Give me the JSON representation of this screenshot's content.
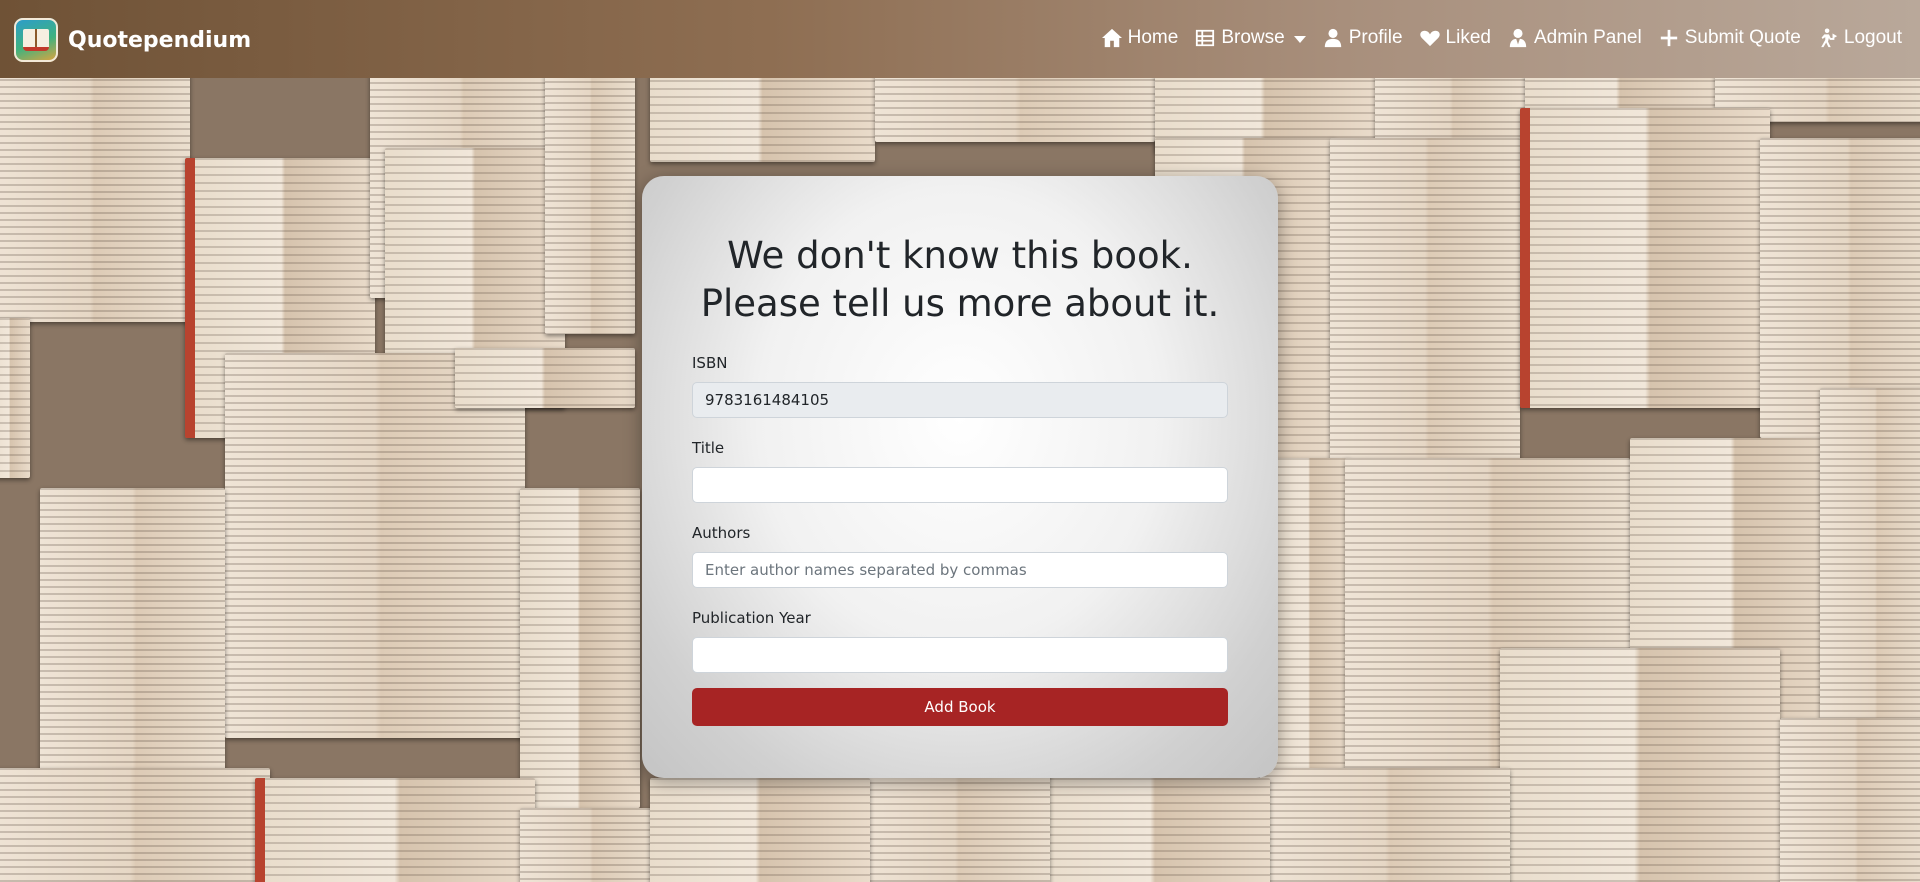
{
  "brand": {
    "name": "Quotependium",
    "logo_icon": "book-logo-icon"
  },
  "nav": {
    "home": {
      "label": "Home",
      "icon": "home-icon"
    },
    "browse": {
      "label": "Browse",
      "icon": "table-icon"
    },
    "profile": {
      "label": "Profile",
      "icon": "user-icon"
    },
    "liked": {
      "label": "Liked",
      "icon": "heart-icon"
    },
    "admin": {
      "label": "Admin Panel",
      "icon": "user-tie-icon"
    },
    "submit": {
      "label": "Submit Quote",
      "icon": "plus-icon"
    },
    "logout": {
      "label": "Logout",
      "icon": "logout-icon"
    }
  },
  "form": {
    "heading_line1": "We don't know this book.",
    "heading_line2": "Please tell us more about it.",
    "isbn": {
      "label": "ISBN",
      "value": "9783161484105"
    },
    "title": {
      "label": "Title",
      "value": "",
      "placeholder": ""
    },
    "authors": {
      "label": "Authors",
      "value": "",
      "placeholder": "Enter author names separated by commas"
    },
    "year": {
      "label": "Publication Year",
      "value": "",
      "placeholder": ""
    },
    "submit_label": "Add Book"
  },
  "colors": {
    "navbar_start": "#6f5236",
    "navbar_end": "#b9a89a",
    "button": "#a72424",
    "text": "#212529"
  }
}
